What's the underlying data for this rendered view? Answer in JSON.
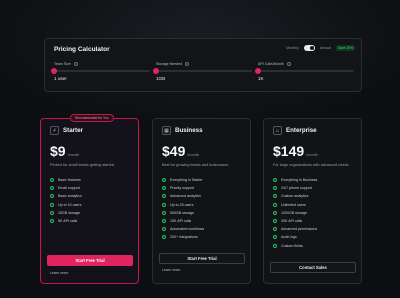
{
  "calculator": {
    "title": "Pricing Calculator",
    "billing": {
      "monthly_label": "Monthly",
      "annual_label": "Annual",
      "save_badge": "Save 20%",
      "annual_selected": true
    },
    "sliders": [
      {
        "label": "Team Size",
        "value": "1 user",
        "fraction": 0.0
      },
      {
        "label": "Storage Needed",
        "value": "1GB",
        "fraction": 0.0
      },
      {
        "label": "API Calls/Month",
        "value": "1K",
        "fraction": 0.0
      }
    ]
  },
  "plans": [
    {
      "name": "Starter",
      "icon": "bolt-icon",
      "price": "$9",
      "period": "/month",
      "badge": "Recommended for You",
      "description": "Perfect for small teams getting started",
      "features": [
        "Basic features",
        "Email support",
        "Basic analytics",
        "Up to 10 users",
        "25GB storage",
        "5K API calls"
      ],
      "cta": "Start Free Trial",
      "learn_more": "Learn more"
    },
    {
      "name": "Business",
      "icon": "building-icon",
      "price": "$49",
      "period": "/month",
      "description": "Best for growing teams and businesses",
      "features": [
        "Everything in Starter",
        "Priority support",
        "Advanced analytics",
        "Up to 25 users",
        "500GB storage",
        "10K API calls",
        "Automated workflows",
        "200+ integrations"
      ],
      "cta": "Start Free Trial",
      "learn_more": "Learn more"
    },
    {
      "name": "Enterprise",
      "icon": "enterprise-icon",
      "price": "$149",
      "period": "/month",
      "description": "For large organizations with advanced needs",
      "features": [
        "Everything in Business",
        "24/7 phone support",
        "Custom analytics",
        "Unlimited users",
        "1000GB storage",
        "20K API calls",
        "Advanced permissions",
        "Audit logs",
        "Custom fields"
      ],
      "cta": "Contact Sales"
    }
  ],
  "colors": {
    "accent": "#e0245e",
    "check": "#22c55e",
    "background": "#0d0f12"
  }
}
